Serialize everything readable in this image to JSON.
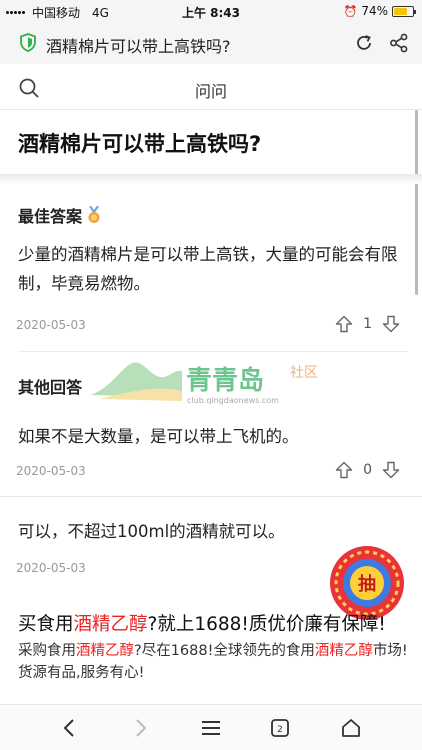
{
  "status_bar": {
    "carrier": "中国移动",
    "network": "4G",
    "time": "上午 8:43",
    "battery_percent": "74%",
    "battery_level": 0.74
  },
  "browser": {
    "page_title": "酒精棉片可以带上高铁吗?",
    "icons": [
      "shield-icon",
      "reload-icon",
      "share-icon"
    ]
  },
  "search": {
    "label": "问问"
  },
  "question": {
    "title": "酒精棉片可以带上高铁吗?"
  },
  "best_answer": {
    "heading": "最佳答案",
    "body": "少量的酒精棉片是可以带上高铁，大量的可能会有限制，毕竟易燃物。",
    "date": "2020-05-03",
    "votes": "1"
  },
  "watermark": {
    "brand": "青青岛",
    "suffix": "社区",
    "url": "club.qingdaonews.com"
  },
  "other_answers": {
    "heading": "其他回答",
    "items": [
      {
        "body": "如果不是大数量，是可以带上飞机的。",
        "date": "2020-05-03",
        "votes": "0"
      },
      {
        "body": "可以，不超过100ml的酒精就可以。",
        "date": "2020-05-03"
      }
    ]
  },
  "lottery": {
    "label": "抽"
  },
  "ad": {
    "title_pre": "买食用",
    "title_hl": "酒精乙醇",
    "title_post": "?就上1688!质优价廉有保障!",
    "desc_1": "采购食用",
    "desc_hl1": "酒精乙醇",
    "desc_2": "?尽在1688!全球领先的食用",
    "desc_hl2": "酒精乙醇",
    "desc_3": "市场!货源有品,服务有心!"
  },
  "colors": {
    "accent_green": "#2bb24c",
    "highlight_red": "#e22222",
    "battery_yellow": "#f4c400"
  }
}
